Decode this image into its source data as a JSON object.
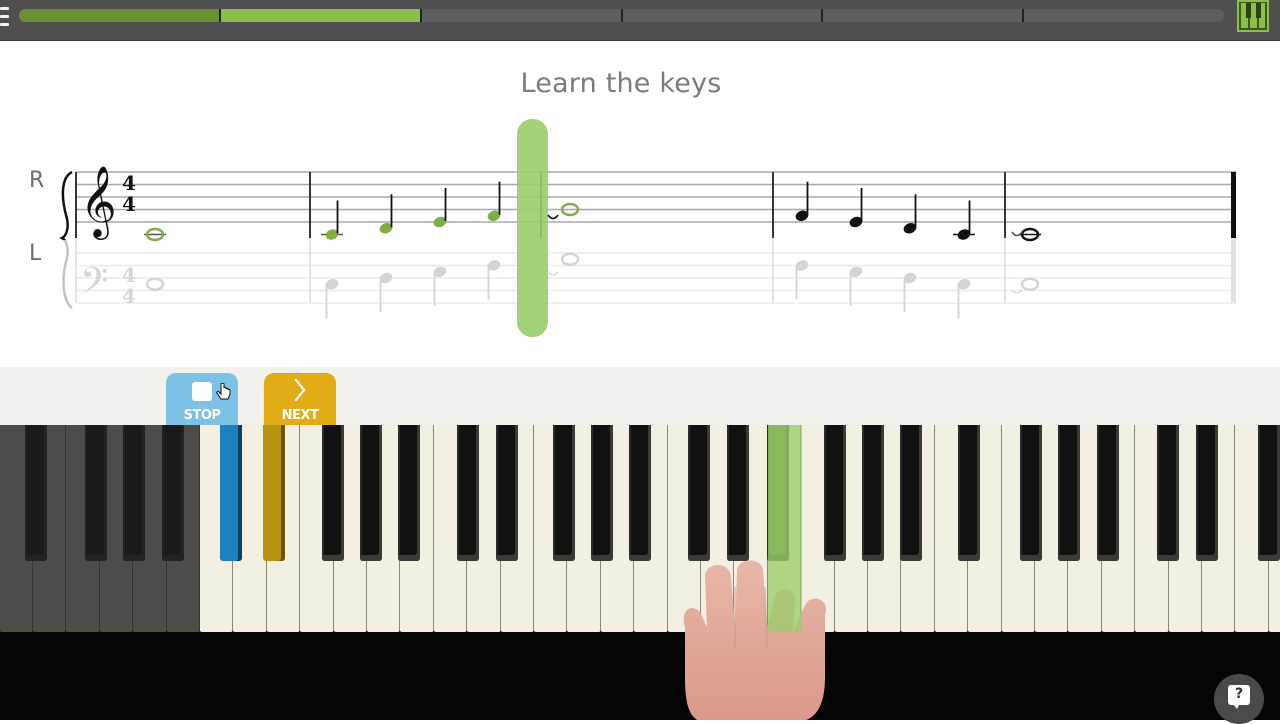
{
  "app": {
    "lesson_title": "Learn the keys"
  },
  "topbar": {
    "menu_icon": "hamburger-menu-icon",
    "keyboard_icon": "piano-keyboard-icon",
    "progress": {
      "segments_total": 6,
      "segments_completed": 1,
      "current_segment": 2,
      "colors": {
        "completed": "#6a9232",
        "current": "#8cbf4a",
        "remaining": "#5e5e5e"
      }
    }
  },
  "score": {
    "right_hand_label": "R",
    "left_hand_label": "L",
    "time_signature": {
      "top": "4",
      "bottom": "4"
    },
    "treble_clef": "𝄞",
    "bass_clef": "𝄢",
    "playhead_color": "#9acd6a",
    "measures": [
      {
        "rh": [
          {
            "pitch": "C4",
            "dur": "whole",
            "state": "played"
          }
        ],
        "lh": [
          {
            "pitch": "C3",
            "dur": "whole"
          }
        ]
      },
      {
        "rh": [
          {
            "pitch": "C4",
            "dur": "quarter",
            "state": "played"
          },
          {
            "pitch": "D4",
            "dur": "quarter",
            "state": "played"
          },
          {
            "pitch": "E4",
            "dur": "quarter",
            "state": "played"
          },
          {
            "pitch": "F4",
            "dur": "quarter",
            "state": "played"
          }
        ],
        "lh": [
          {
            "pitch": "C3",
            "dur": "quarter"
          },
          {
            "pitch": "D3",
            "dur": "quarter"
          },
          {
            "pitch": "E3",
            "dur": "quarter"
          },
          {
            "pitch": "F3",
            "dur": "quarter"
          }
        ]
      },
      {
        "rh": [
          {
            "pitch": "G4",
            "dur": "whole",
            "state": "current"
          }
        ],
        "lh": [
          {
            "pitch": "G3",
            "dur": "whole"
          }
        ]
      },
      {
        "rh": [
          {
            "pitch": "F4",
            "dur": "quarter",
            "state": "upcoming"
          },
          {
            "pitch": "E4",
            "dur": "quarter",
            "state": "upcoming"
          },
          {
            "pitch": "D4",
            "dur": "quarter",
            "state": "upcoming"
          },
          {
            "pitch": "C4",
            "dur": "quarter",
            "state": "upcoming"
          }
        ],
        "lh": [
          {
            "pitch": "F3",
            "dur": "quarter"
          },
          {
            "pitch": "E3",
            "dur": "quarter"
          },
          {
            "pitch": "D3",
            "dur": "quarter"
          },
          {
            "pitch": "C3",
            "dur": "quarter"
          }
        ]
      },
      {
        "rh": [
          {
            "pitch": "C4",
            "dur": "whole",
            "state": "upcoming"
          }
        ],
        "lh": [
          {
            "pitch": "C3",
            "dur": "whole"
          }
        ]
      }
    ]
  },
  "controls": {
    "stop": {
      "label": "STOP",
      "icon": "stop-square-icon",
      "color": "#7cc1e6"
    },
    "next": {
      "label": "NEXT",
      "icon": "chevron-right-icon",
      "color": "#e1ad17"
    }
  },
  "keyboard": {
    "highlights": {
      "stop_key_color": "#1b7fc0",
      "next_key_color": "#b8930f",
      "target_key_color": "#9acd6a"
    }
  },
  "help": {
    "icon": "help-question-bubble-icon",
    "label": "?"
  }
}
